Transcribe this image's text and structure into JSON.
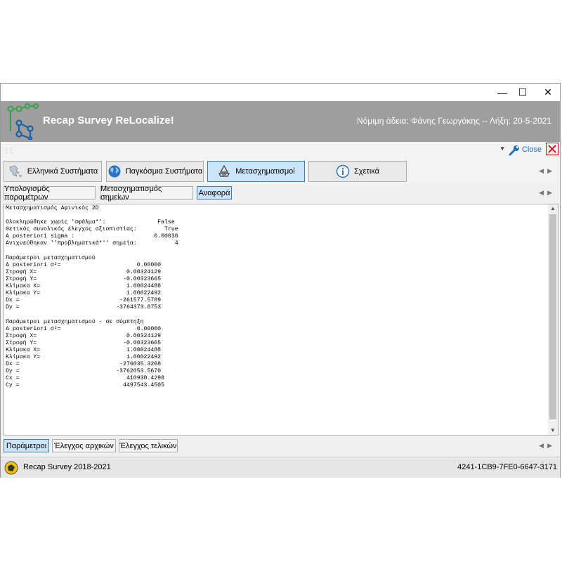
{
  "window": {
    "controls": {
      "minimize": "—",
      "maximize": "☐",
      "close": "✕"
    }
  },
  "header": {
    "app_title": "Recap Survey ReLocalize!",
    "license": "Νόμιμη άδεια: Φάνης Γεωργάκης -- Λήξη: 20-5-2021",
    "bg_color": "#9e9e9e"
  },
  "toolstrip": {
    "close_label": "Close"
  },
  "main_tabs": [
    {
      "label": "Ελληνικά Συστήματα",
      "icon": "greece-map-icon"
    },
    {
      "label": "Παγκόσμια Συστήματα",
      "icon": "globe-icon"
    },
    {
      "label": "Μετασχηματισμοί",
      "icon": "transform-icon",
      "active": true
    },
    {
      "label": "Σχετικά",
      "icon": "info-icon"
    }
  ],
  "sub_tabs": [
    {
      "label": "Υπολογισμός παραμέτρων"
    },
    {
      "label": "Μετασχηματισμός σημείων"
    },
    {
      "label": "Αναφορά",
      "active": true
    }
  ],
  "report": {
    "text": "Μετασχηματισμός Αφινικός 2D\n\nΟλοκληρώθηκε χωρίς 'σφάλμα*':               False\nΘετικός συνολικός έλεγχος αξιοπιστίας:        True\nA posteriori sigma :                       0.00030\nΑνιχνεύθηκαν ''προβληματικά*'' σημεία:           4\n\nΠαράμετροι μετασχηματισμού\nA posteriori σ²=                      0.00000\nΣτροφή X=                          0.00324129\nΣτροφή Y=                         -0.00323665\nΚλίμακα X=                         1.00024488\nΚλίμακα Y=                         1.00022492\nDx =                             -261577.5789\nDy =                            -3764373.8753\n\nΠαράμετροι μετασχηματισμού - σε σύμπτηξη\nA posteriori σ²=                      0.00000\nΣτροφή X=                          0.00324129\nΣτροφή Y=                         -0.00323665\nΚλίμακα X=                         1.00024488\nΚλίμακα Y=                         1.00022492\nDx =                             -276035.3268\nDy =                            -3762053.5670\nCx =                               410930.4298\nCy =                              4497543.4505"
  },
  "bottom_tabs": [
    {
      "label": "Παράμετροι",
      "active": true
    },
    {
      "label": "Έλεγχος αρχικών"
    },
    {
      "label": "Έλεγχος τελικών"
    }
  ],
  "status": {
    "left": "Recap Survey 2018-2021",
    "right": "4241-1CB9-7FE0-6647-3171"
  }
}
